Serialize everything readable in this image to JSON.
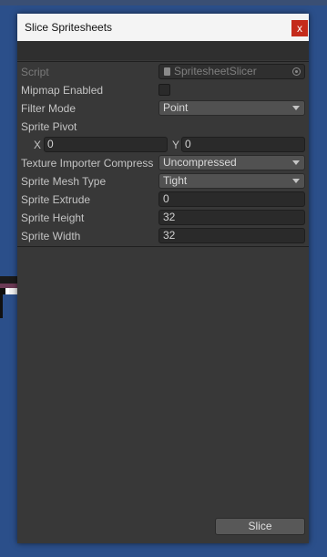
{
  "window": {
    "title": "Slice Spritesheets",
    "close_glyph": "x"
  },
  "inspector": {
    "script": {
      "label": "Script",
      "value": "SpritesheetSlicer",
      "icon": "script-icon"
    },
    "mipmap": {
      "label": "Mipmap Enabled",
      "checked": false
    },
    "filter_mode": {
      "label": "Filter Mode",
      "value": "Point"
    },
    "sprite_pivot": {
      "label": "Sprite Pivot",
      "x_label": "X",
      "x_value": "0",
      "y_label": "Y",
      "y_value": "0"
    },
    "compression": {
      "label": "Texture Importer Compress",
      "value": "Uncompressed"
    },
    "mesh_type": {
      "label": "Sprite Mesh Type",
      "value": "Tight"
    },
    "extrude": {
      "label": "Sprite Extrude",
      "value": "0"
    },
    "height": {
      "label": "Sprite Height",
      "value": "32"
    },
    "width": {
      "label": "Sprite Width",
      "value": "32"
    }
  },
  "slice_button": {
    "label": "Slice"
  },
  "colors": {
    "desktop": "#2b4f8a",
    "panel": "#383838",
    "close": "#c42b1c"
  }
}
